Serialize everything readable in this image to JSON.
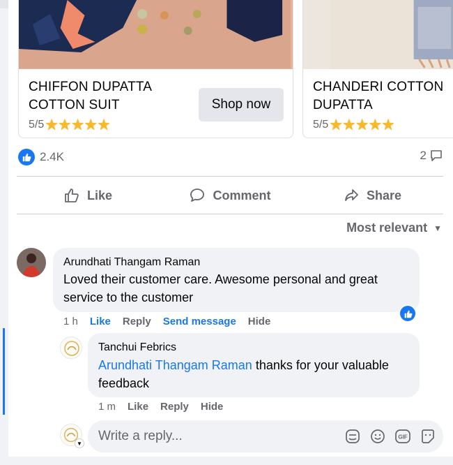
{
  "products": [
    {
      "name_line1": "CHIFFON DUPATTA",
      "name_line2": "COTTON SUIT",
      "rating": "5/5",
      "stars": "★★★★★",
      "button": "Shop now"
    },
    {
      "name_line1": "CHANDERI COTTON",
      "name_line2": "DUPATTA",
      "rating": "5/5",
      "stars": "★★★★★"
    }
  ],
  "post_stats": {
    "reactions_count": "2.4K",
    "comments_count": "2"
  },
  "actions": {
    "like": "Like",
    "comment": "Comment",
    "share": "Share"
  },
  "sort": {
    "label": "Most relevant"
  },
  "comment": {
    "author": "Arundhati Thangam Raman",
    "text": "Loved their customer care. Awesome personal and great service to the customer",
    "time": "1 h",
    "like": "Like",
    "reply": "Reply",
    "send_message": "Send message",
    "hide": "Hide"
  },
  "reply": {
    "author": "Tanchui Febrics",
    "mention": "Arundhati Thangam Raman",
    "text": " thanks for your valuable feedback",
    "time": "1 m",
    "like": "Like",
    "reply": "Reply",
    "hide": "Hide"
  },
  "reply_input": {
    "placeholder": "Write a reply..."
  },
  "colors": {
    "accent": "#1877f2",
    "star": "#f7b928",
    "muted": "#65676b"
  },
  "icons": [
    "like-reaction-icon",
    "comment-count-icon",
    "thumbs-up-icon",
    "comment-icon",
    "share-icon",
    "caret-down-icon",
    "sticker-icon",
    "emoji-icon",
    "gif-icon",
    "avatar-sticker-icon"
  ]
}
